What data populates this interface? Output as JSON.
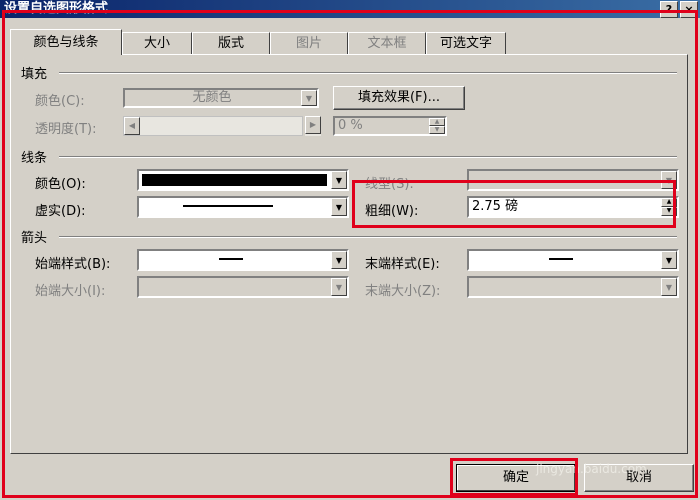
{
  "window": {
    "title": "设置自选图形格式",
    "help_label": "?",
    "close_label": "×"
  },
  "tabs": [
    {
      "label": "颜色与线条",
      "active": true
    },
    {
      "label": "大小"
    },
    {
      "label": "版式"
    },
    {
      "label": "图片",
      "disabled": true
    },
    {
      "label": "文本框",
      "disabled": true
    },
    {
      "label": "可选文字"
    }
  ],
  "fill": {
    "section": "填充",
    "color_label": "颜色(C):",
    "color_value": "无颜色",
    "effects_button": "填充效果(F)...",
    "transparency_label": "透明度(T):",
    "transparency_value": "0 %"
  },
  "line": {
    "section": "线条",
    "color_label": "颜色(O):",
    "color_value": "#000000",
    "dash_label": "虚实(D):",
    "style_label": "线型(S):",
    "weight_label": "粗细(W):",
    "weight_value": "2.75 磅"
  },
  "arrows": {
    "section": "箭头",
    "begin_style_label": "始端样式(B):",
    "end_style_label": "末端样式(E):",
    "begin_size_label": "始端大小(I):",
    "end_size_label": "末端大小(Z):"
  },
  "footer": {
    "ok_button": "确定",
    "cancel_button": "取消",
    "watermark": "jingyan.baidu.com"
  },
  "colors": {
    "highlight": "#e0001b",
    "titlebar": "#0a246a"
  }
}
